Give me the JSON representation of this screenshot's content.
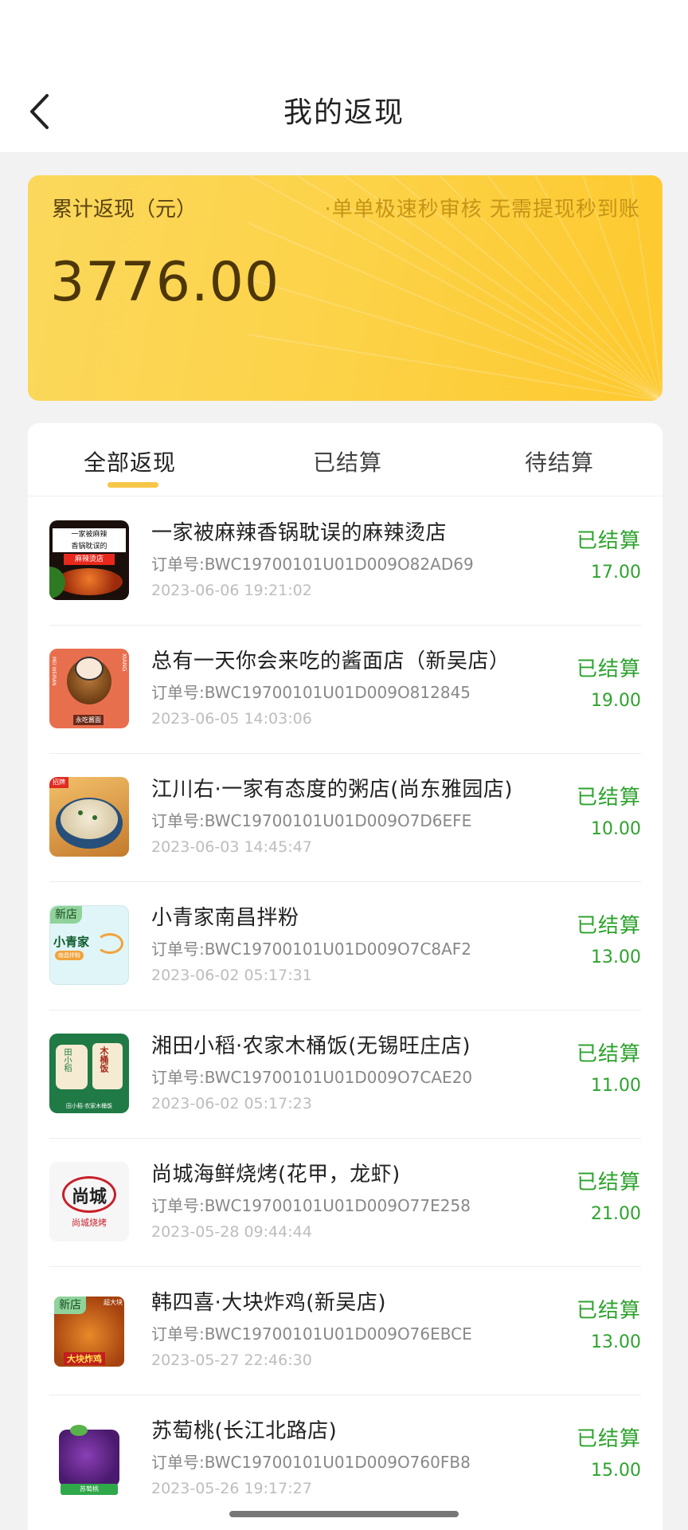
{
  "header": {
    "title": "我的返现",
    "back_icon": "chevron-left-icon"
  },
  "summary": {
    "label": "累计返现（元）",
    "slogan": "·单单极速秒审核 无需提现秒到账",
    "amount": "3776.00"
  },
  "tabs": [
    {
      "label": "全部返现",
      "active": true
    },
    {
      "label": "已结算",
      "active": false
    },
    {
      "label": "待结算",
      "active": false
    }
  ],
  "orders": [
    {
      "name": "一家被麻辣香锅耽误的麻辣烫店",
      "order_no": "订单号:BWC19700101U01D009O82AD69",
      "time": "2023-06-06 19:21:02",
      "status": "已结算",
      "amount": "17.00"
    },
    {
      "name": "总有一天你会来吃的酱面店（新吴店）",
      "order_no": "订单号:BWC19700101U01D009O812845",
      "time": "2023-06-05 14:03:06",
      "status": "已结算",
      "amount": "19.00"
    },
    {
      "name": "江川右·一家有态度的粥店(尚东雅园店)",
      "order_no": "订单号:BWC19700101U01D009O7D6EFE",
      "time": "2023-06-03 14:45:47",
      "status": "已结算",
      "amount": "10.00"
    },
    {
      "name": "小青家南昌拌粉",
      "order_no": "订单号:BWC19700101U01D009O7C8AF2",
      "time": "2023-06-02 05:17:31",
      "status": "已结算",
      "amount": "13.00"
    },
    {
      "name": "湘田小稻·农家木桶饭(无锡旺庄店)",
      "order_no": "订单号:BWC19700101U01D009O7CAE20",
      "time": "2023-06-02 05:17:23",
      "status": "已结算",
      "amount": "11.00"
    },
    {
      "name": "尚城海鲜烧烤(花甲，龙虾)",
      "order_no": "订单号:BWC19700101U01D009O77E258",
      "time": "2023-05-28 09:44:44",
      "status": "已结算",
      "amount": "21.00"
    },
    {
      "name": "韩四喜·大块炸鸡(新吴店)",
      "order_no": "订单号:BWC19700101U01D009O76EBCE",
      "time": "2023-05-27 22:46:30",
      "status": "已结算",
      "amount": "13.00"
    },
    {
      "name": "苏萄桃(长江北路店)",
      "order_no": "订单号:BWC19700101U01D009O760FB8",
      "time": "2023-05-26 19:17:27",
      "status": "已结算",
      "amount": "15.00"
    }
  ],
  "thumbs": {
    "t1": {
      "text1": "一家被麻辣",
      "text2": "香锅耽误的",
      "text3": "麻辣烫店"
    },
    "t2": {
      "side": "XIANG",
      "side2": "MEI WEIRAN",
      "bottom": "永吃酱面"
    },
    "t3": {
      "tag": "招牌"
    },
    "t4": {
      "badge": "新店",
      "brand": "小青家",
      "sub": "南昌拌粉"
    },
    "t5": {
      "a": "田小稻",
      "b": "木桶饭",
      "c": "田小稻·农家木桶饭"
    },
    "t6": {
      "main": "尚城",
      "sub": "尚城烧烤"
    },
    "t7": {
      "badge": "新店",
      "corner": "超大块",
      "bottom": "大块炸鸡"
    },
    "t8": {
      "bottom": "苏萄桃"
    }
  }
}
